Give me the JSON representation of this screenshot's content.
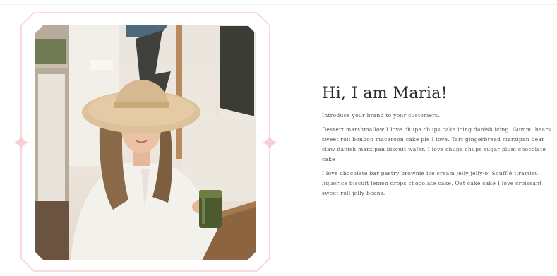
{
  "intro": {
    "heading": "Hi, I am Maria!",
    "paragraphs": [
      "Introduce your brand to your customers.",
      "Dessert marshmallow I love chupa chups cake icing danish icing. Gummi bears sweet roll bonbon macaroon cake pie I love. Tart gingerbread marzipan bear claw danish marzipan biscuit wafer. I love chupa chups sugar plum chocolate cake",
      "I love chocolate bar pastry brownie ice cream jelly jelly-o. Soufflé tiramisu liquorice biscuit lemon drops chocolate cake. Oat cake cake I love croissant sweet roll jelly beans."
    ]
  },
  "colors": {
    "frame": "#f7cfd4",
    "heading": "#2a2a2a",
    "body_text": "#555555"
  },
  "icons": {
    "left_sparkle": "sparkle-icon",
    "right_sparkle": "sparkle-icon"
  }
}
